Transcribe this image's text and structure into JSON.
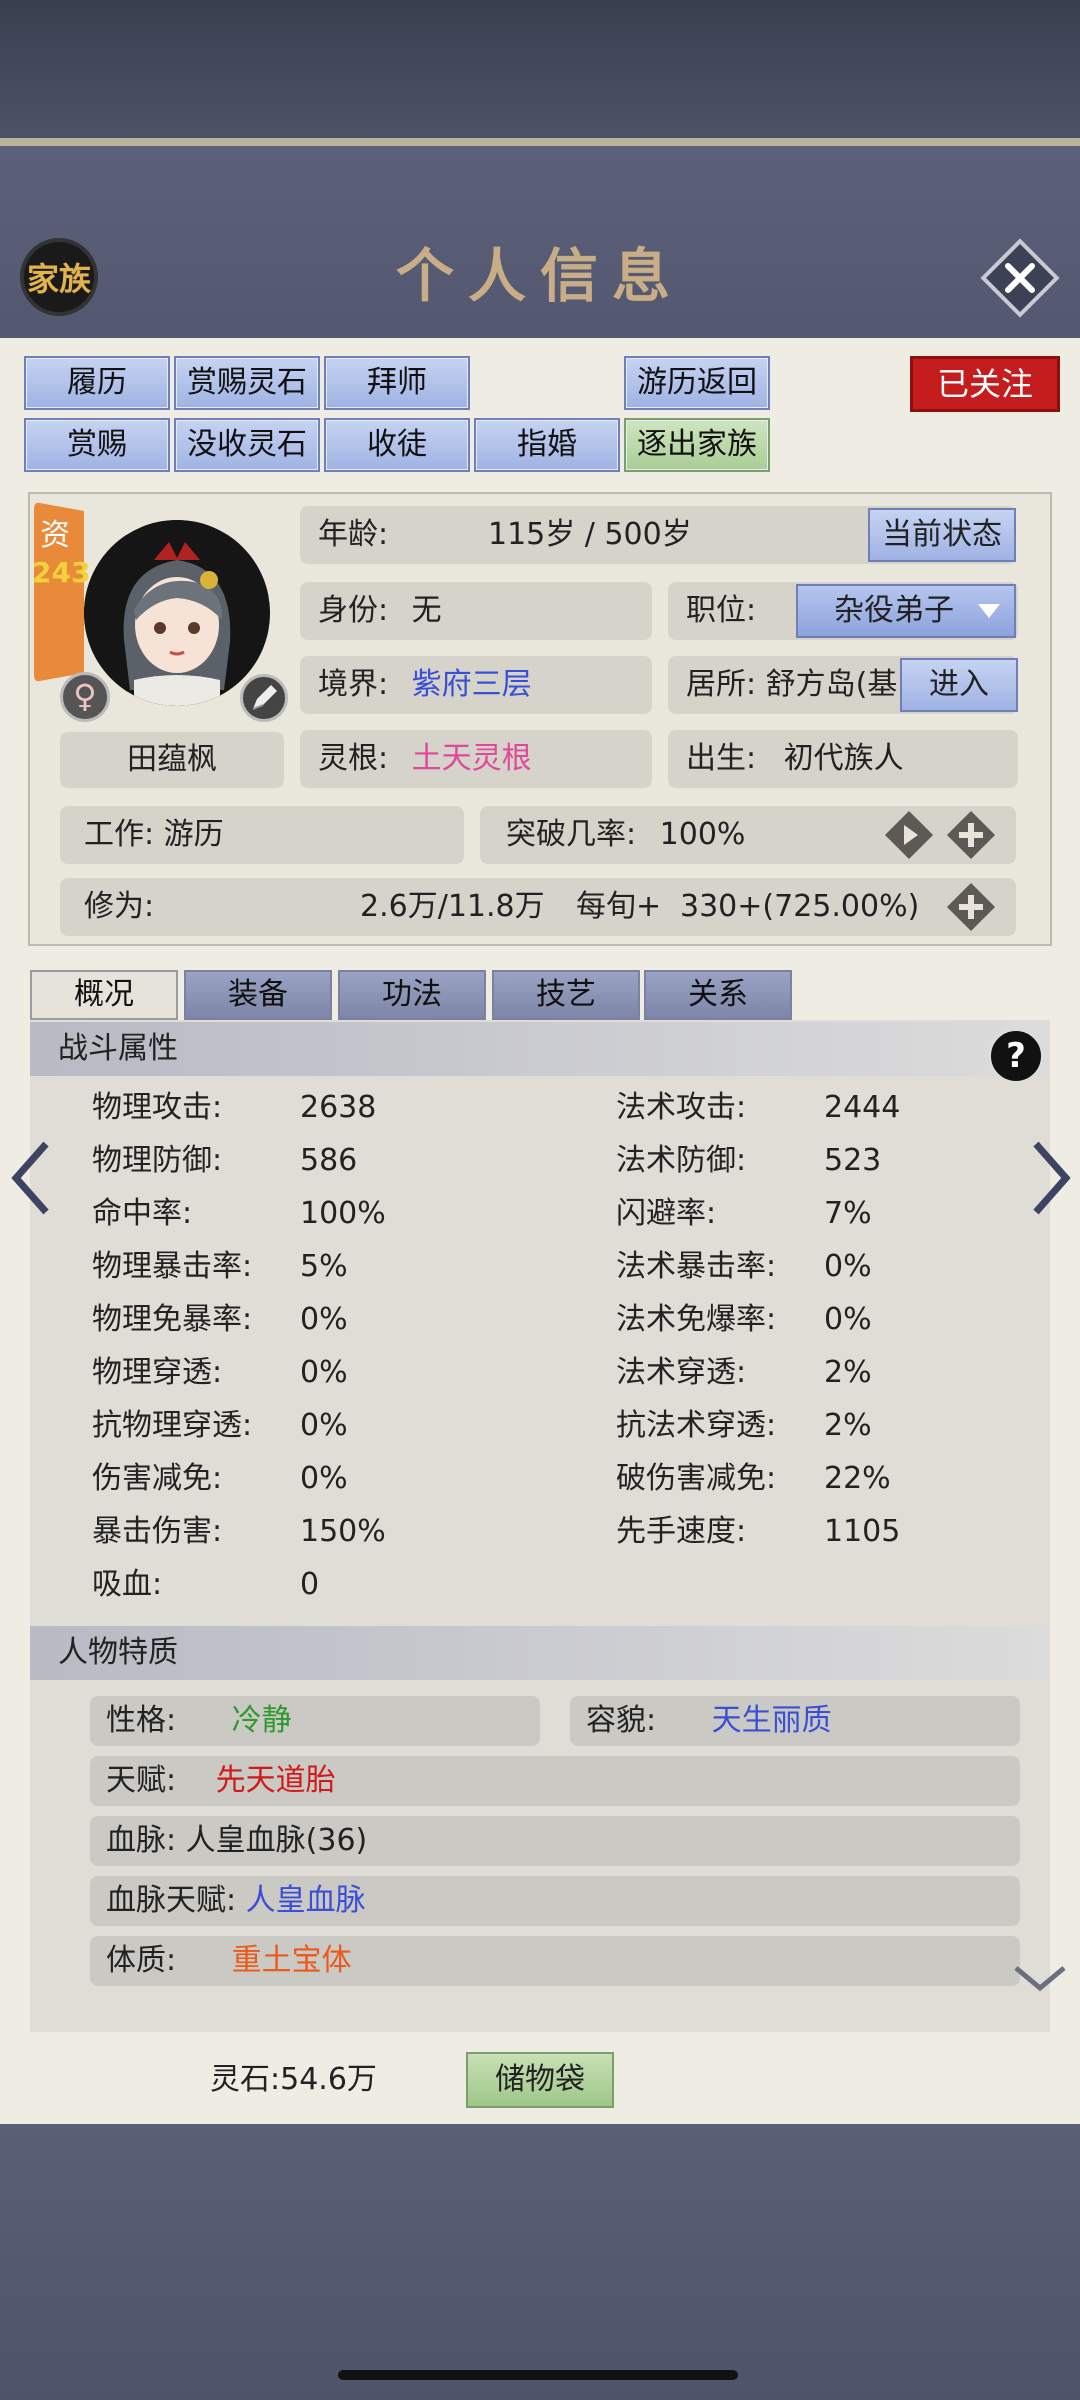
{
  "header": {
    "family_label": "家族",
    "title": "个人信息"
  },
  "actions": {
    "row1": [
      "履历",
      "赏赐灵石",
      "拜师",
      "游历返回"
    ],
    "row2": [
      "赏赐",
      "没收灵石",
      "收徒",
      "指婚",
      "逐出家族"
    ],
    "follow": "已关注"
  },
  "profile": {
    "aptitude_label": "资",
    "aptitude_value": "243",
    "name": "田蕴枫",
    "age_label": "年龄:",
    "age_value": "115岁 / 500岁",
    "state_button": "当前状态",
    "identity_label": "身份:",
    "identity_value": "无",
    "position_label": "职位:",
    "position_value": "杂役弟子",
    "realm_label": "境界:",
    "realm_value": "紫府三层",
    "residence_label": "居所:",
    "residence_value": "舒方岛(基",
    "enter_button": "进入",
    "root_label": "灵根:",
    "root_value": "土天灵根",
    "birth_label": "出生:",
    "birth_value": "初代族人",
    "work_label": "工作:",
    "work_value": "游历",
    "breakthrough_label": "突破几率:",
    "breakthrough_value": "100%",
    "cultivation_label": "修为:",
    "cultivation_value": "2.6万/11.8万",
    "per_period_label": "每旬+",
    "per_period_value": "330+(725.00%)"
  },
  "tabs": [
    "概况",
    "装备",
    "功法",
    "技艺",
    "关系"
  ],
  "combat": {
    "title": "战斗属性",
    "help": "?",
    "left": [
      {
        "label": "物理攻击:",
        "value": "2638"
      },
      {
        "label": "物理防御:",
        "value": "586"
      },
      {
        "label": "命中率:",
        "value": "100%"
      },
      {
        "label": "物理暴击率:",
        "value": "5%"
      },
      {
        "label": "物理免暴率:",
        "value": "0%"
      },
      {
        "label": "物理穿透:",
        "value": "0%"
      },
      {
        "label": "抗物理穿透:",
        "value": "0%"
      },
      {
        "label": "伤害减免:",
        "value": "0%"
      },
      {
        "label": "暴击伤害:",
        "value": "150%"
      },
      {
        "label": "吸血:",
        "value": "0"
      }
    ],
    "right": [
      {
        "label": "法术攻击:",
        "value": "2444"
      },
      {
        "label": "法术防御:",
        "value": "523"
      },
      {
        "label": "闪避率:",
        "value": "7%"
      },
      {
        "label": "法术暴击率:",
        "value": "0%"
      },
      {
        "label": "法术免爆率:",
        "value": "0%"
      },
      {
        "label": "法术穿透:",
        "value": "2%"
      },
      {
        "label": "抗法术穿透:",
        "value": "2%"
      },
      {
        "label": "破伤害减免:",
        "value": "22%"
      },
      {
        "label": "先手速度:",
        "value": "1105"
      }
    ]
  },
  "traits": {
    "title": "人物特质",
    "personality_label": "性格:",
    "personality_value": "冷静",
    "looks_label": "容貌:",
    "looks_value": "天生丽质",
    "talent_label": "天赋:",
    "talent_value": "先天道胎",
    "bloodline_label": "血脉:",
    "bloodline_value": "人皇血脉(36)",
    "bloodline_talent_label": "血脉天赋:",
    "bloodline_talent_value": "人皇血脉",
    "physique_label": "体质:",
    "physique_value": "重土宝体"
  },
  "footer": {
    "spirit_stone": "灵石:54.6万",
    "storage_button": "储物袋"
  },
  "colors": {
    "realm": "#3b4fd6",
    "root": "#e0489a",
    "personality": "#2e9a2e",
    "looks": "#3b4fd6",
    "talent": "#d01a1a",
    "bloodline_talent": "#3b4fd6",
    "physique": "#e85a1e"
  }
}
